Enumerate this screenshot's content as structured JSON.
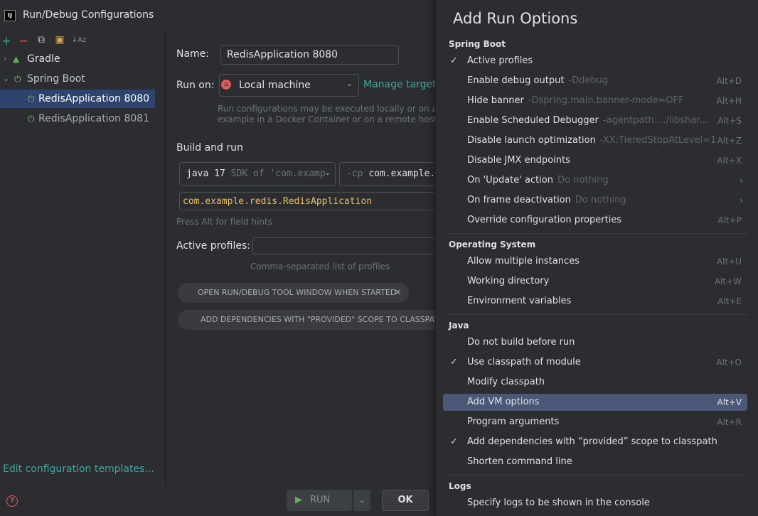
{
  "window": {
    "title": "Run/Debug Configurations",
    "logo": "IJ"
  },
  "toolbar": {
    "add": "+",
    "remove": "−",
    "copy": "⧉",
    "folder": "▣",
    "sort": "↓Az"
  },
  "tree": {
    "gradle": "Gradle",
    "spring_boot": "Spring Boot",
    "configs": [
      "RedisApplication 8080",
      "RedisApplication 8081"
    ]
  },
  "edit_templates": "Edit configuration templates...",
  "form": {
    "name_label": "Name:",
    "name_value": "RedisApplication 8080",
    "run_on_label": "Run on:",
    "run_on_value": "Local machine",
    "manage_targets": "Manage targets",
    "run_on_hint_1": "Run configurations may be executed locally or on a targ",
    "run_on_hint_2": "example in a Docker Container or on a remote host usir",
    "build_and_run": "Build and run",
    "jdk_main": "java 17",
    "jdk_detail": "SDK of 'com.examp",
    "cp_flag": "-cp",
    "cp_value": "com.example.",
    "main_class": "com.example.redis.RedisApplication",
    "field_hint": "Press Alt for field hints",
    "profiles_label": "Active profiles:",
    "profiles_value": "",
    "profiles_hint": "Comma-separated list of profiles",
    "chip_open": "OPEN RUN/DEBUG TOOL WINDOW WHEN STARTED",
    "chip_open_close": "×",
    "chip_deps": "ADD DEPENDENCIES WITH \"PROVIDED\" SCOPE TO CLASSPATH"
  },
  "bottom": {
    "help": "?",
    "run": "RUN",
    "ok": "OK"
  },
  "popup": {
    "title": "Add Run Options",
    "sections": {
      "spring_boot": "Spring Boot",
      "os": "Operating System",
      "java": "Java",
      "logs": "Logs"
    },
    "spring": [
      {
        "check": "✓",
        "name": "Active profiles",
        "detail": "",
        "shortcut": ""
      },
      {
        "check": "",
        "name": "Enable debug output",
        "detail": "-Ddebug",
        "shortcut": "Alt+D"
      },
      {
        "check": "",
        "name": "Hide banner",
        "detail": "-Dspring.main.banner-mode=OFF",
        "shortcut": "Alt+H"
      },
      {
        "check": "",
        "name": "Enable Scheduled Debugger",
        "detail": "-agentpath:.../libshar...",
        "shortcut": "Alt+S"
      },
      {
        "check": "",
        "name": "Disable launch optimization",
        "detail": "-XX:TieredStopAtLevel=1",
        "shortcut": "Alt+Z"
      },
      {
        "check": "",
        "name": "Disable JMX endpoints",
        "detail": "",
        "shortcut": "Alt+X"
      },
      {
        "check": "",
        "name": "On 'Update' action",
        "detail": "Do nothing",
        "shortcut": "›"
      },
      {
        "check": "",
        "name": "On frame deactivation",
        "detail": "Do nothing",
        "shortcut": "›"
      },
      {
        "check": "",
        "name": "Override configuration properties",
        "detail": "",
        "shortcut": "Alt+P"
      }
    ],
    "os": [
      {
        "check": "",
        "name": "Allow multiple instances",
        "detail": "",
        "shortcut": "Alt+U"
      },
      {
        "check": "",
        "name": "Working directory",
        "detail": "",
        "shortcut": "Alt+W"
      },
      {
        "check": "",
        "name": "Environment variables",
        "detail": "",
        "shortcut": "Alt+E"
      }
    ],
    "java": [
      {
        "check": "",
        "name": "Do not build before run",
        "detail": "",
        "shortcut": ""
      },
      {
        "check": "✓",
        "name": "Use classpath of module",
        "detail": "",
        "shortcut": "Alt+O"
      },
      {
        "check": "",
        "name": "Modify classpath",
        "detail": "",
        "shortcut": ""
      },
      {
        "check": "",
        "name": "Add VM options",
        "detail": "",
        "shortcut": "Alt+V"
      },
      {
        "check": "",
        "name": "Program arguments",
        "detail": "",
        "shortcut": "Alt+R"
      },
      {
        "check": "✓",
        "name": "Add dependencies with “provided” scope to classpath",
        "detail": "",
        "shortcut": ""
      },
      {
        "check": "",
        "name": "Shorten command line",
        "detail": "",
        "shortcut": ""
      }
    ],
    "logs": [
      {
        "check": "",
        "name": "Specify logs to be shown in the console",
        "detail": "",
        "shortcut": ""
      }
    ]
  },
  "colors": {
    "accent": "#3ba7a0",
    "selection": "#2e436e",
    "highlight": "#4a5877",
    "main_class": "#e8bf6a"
  }
}
